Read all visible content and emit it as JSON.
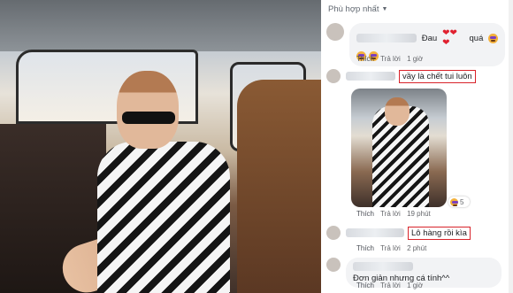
{
  "sort_label": "Phù hợp nhất",
  "comments": [
    {
      "text": "Đau",
      "text_suffix": "quá",
      "hearts": "❤❤❤",
      "like": "Thích",
      "reply": "Trả lời",
      "time": "1 giờ"
    },
    {
      "text": "vầy là chết tui luôn",
      "like": "Thích",
      "reply": "Trả lời",
      "time": "19 phút",
      "reaction_count": "5"
    },
    {
      "text": "Lô hàng rồi kìa",
      "like": "Thích",
      "reply": "Trả lời",
      "time": "2 phút"
    },
    {
      "text": "Đơn giản nhưng cá tính^^",
      "like": "Thích",
      "reply": "Trả lời",
      "time": "1 giờ"
    }
  ]
}
